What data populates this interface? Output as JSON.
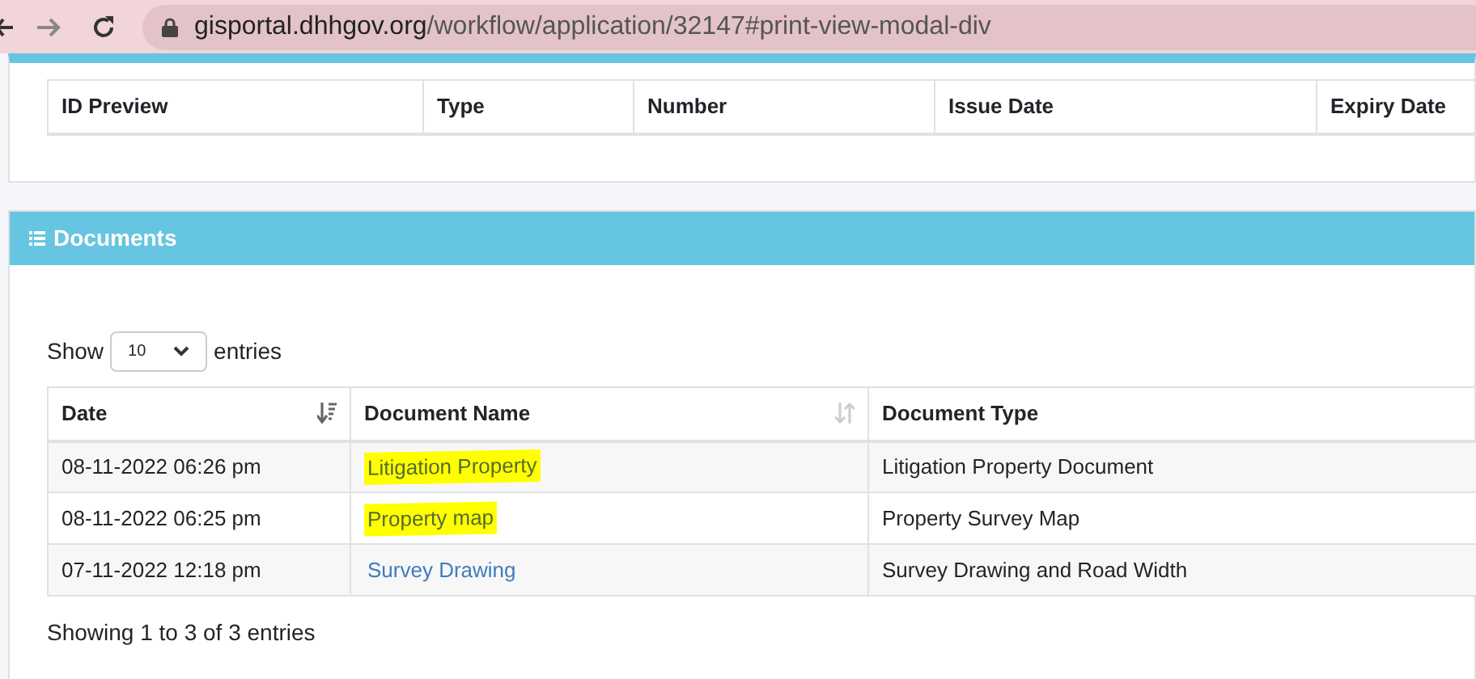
{
  "browser": {
    "url_host": "gisportal.dhhgov.org",
    "url_path": "/workflow/application/32147#print-view-modal-div"
  },
  "id_table": {
    "columns": [
      "ID Preview",
      "Type",
      "Number",
      "Issue Date",
      "Expiry Date"
    ]
  },
  "documents": {
    "title": "Documents",
    "length": {
      "label_before": "Show",
      "value": "10",
      "label_after": "entries"
    },
    "columns": [
      {
        "label": "Date",
        "kind": "sorted"
      },
      {
        "label": "Document Name",
        "kind": "sortable"
      },
      {
        "label": "Document Type",
        "kind": "plain"
      }
    ],
    "rows": [
      {
        "date": "08-11-2022 06:26 pm",
        "name": "Litigation Property",
        "type": "Litigation Property Document",
        "highlighted": true
      },
      {
        "date": "08-11-2022 06:25 pm",
        "name": "Property map",
        "type": "Property Survey Map",
        "highlighted": true
      },
      {
        "date": "07-11-2022 12:18 pm",
        "name": "Survey Drawing",
        "type": "Survey Drawing and Road Width",
        "highlighted": false
      }
    ],
    "info": "Showing 1 to 3 of 3 entries"
  }
}
